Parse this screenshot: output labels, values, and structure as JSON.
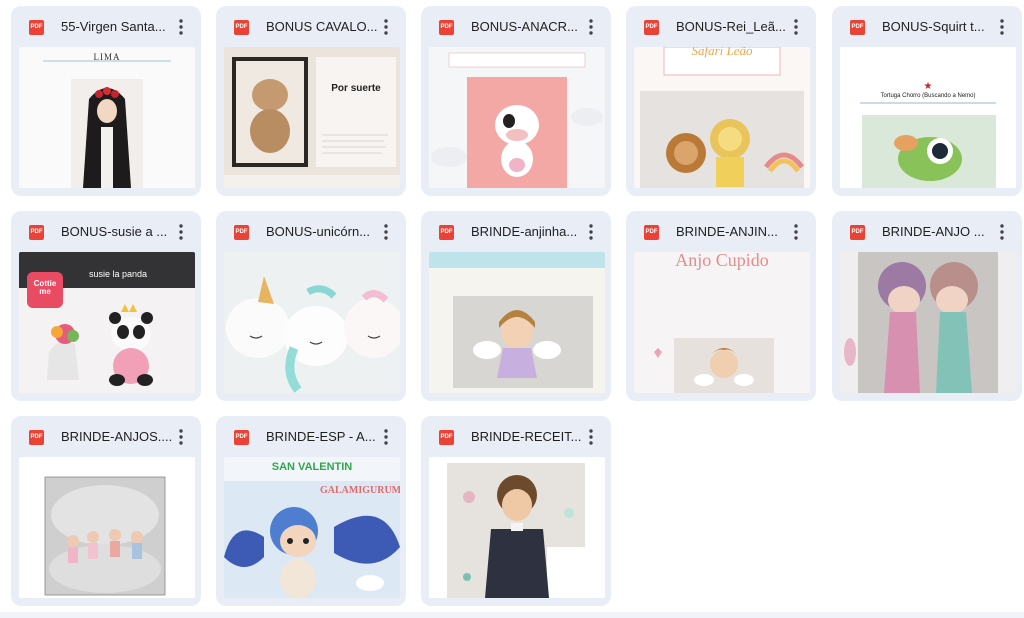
{
  "cards": [
    {
      "title": "55-Virgen Santa...",
      "thumb_text": "LIMA"
    },
    {
      "title": "BONUS CAVALO...",
      "thumb_text": "Por suerte"
    },
    {
      "title": "BONUS-ANACR...",
      "thumb_text": ""
    },
    {
      "title": "BONUS-Rei_Leã...",
      "thumb_text": "Safari Leão"
    },
    {
      "title": "BONUS-Squirt t...",
      "thumb_text": "Tortuga Chorro (Buscando a Nemo)"
    },
    {
      "title": "BONUS-susie a ...",
      "thumb_text": "susie la panda",
      "thumb_logo": "Cottie me"
    },
    {
      "title": "BONUS-unicórn...",
      "thumb_text": ""
    },
    {
      "title": "BRINDE-anjinha...",
      "thumb_text": ""
    },
    {
      "title": "BRINDE-ANJIN...",
      "thumb_text": "Anjo Cupido"
    },
    {
      "title": "BRINDE-ANJO ...",
      "thumb_text": ""
    },
    {
      "title": "BRINDE-ANJOS....",
      "thumb_text": ""
    },
    {
      "title": "BRINDE-ESP - A...",
      "thumb_text": "SAN VALENTIN",
      "thumb_text2": "GALAMIGURUMIS"
    },
    {
      "title": "BRINDE-RECEIT...",
      "thumb_text": ""
    }
  ],
  "icons": {
    "file": "pdf-icon",
    "menu": "more-vert-icon"
  },
  "pdf_badge": "PDF",
  "colors": {
    "card_bg": "#e9eef6",
    "pdf_red": "#ea4335"
  }
}
